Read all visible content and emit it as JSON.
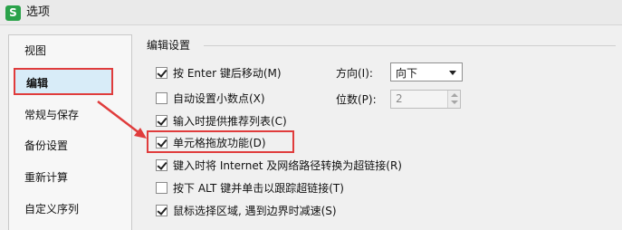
{
  "window": {
    "title": "选项",
    "app_icon_letter": "S"
  },
  "sidebar": {
    "items": [
      {
        "label": "视图"
      },
      {
        "label": "编辑",
        "selected": true
      },
      {
        "label": "常规与保存"
      },
      {
        "label": "备份设置"
      },
      {
        "label": "重新计算"
      },
      {
        "label": "自定义序列"
      }
    ]
  },
  "edit_settings": {
    "group_title": "编辑设置",
    "options": [
      {
        "label": "按 Enter 键后移动(M)",
        "checked": true
      },
      {
        "label": "自动设置小数点(X)",
        "checked": false
      },
      {
        "label": "输入时提供推荐列表(C)",
        "checked": true
      },
      {
        "label": "单元格拖放功能(D)",
        "checked": true
      },
      {
        "label": "键入时将 Internet 及网络路径转换为超链接(R)",
        "checked": true
      },
      {
        "label": "按下 ALT 键并单击以跟踪超链接(T)",
        "checked": false
      },
      {
        "label": "鼠标选择区域, 遇到边界时减速(S)",
        "checked": true
      }
    ],
    "direction_label": "方向(I):",
    "direction_value": "向下",
    "decimal_label": "位数(P):",
    "decimal_value": "2"
  },
  "colors": {
    "annotation_red": "#e03c3c",
    "selected_bg": "#d8ecf8"
  },
  "icons": {
    "app": "wps-spreadsheet-icon",
    "dropdown": "chevron-down-icon"
  }
}
